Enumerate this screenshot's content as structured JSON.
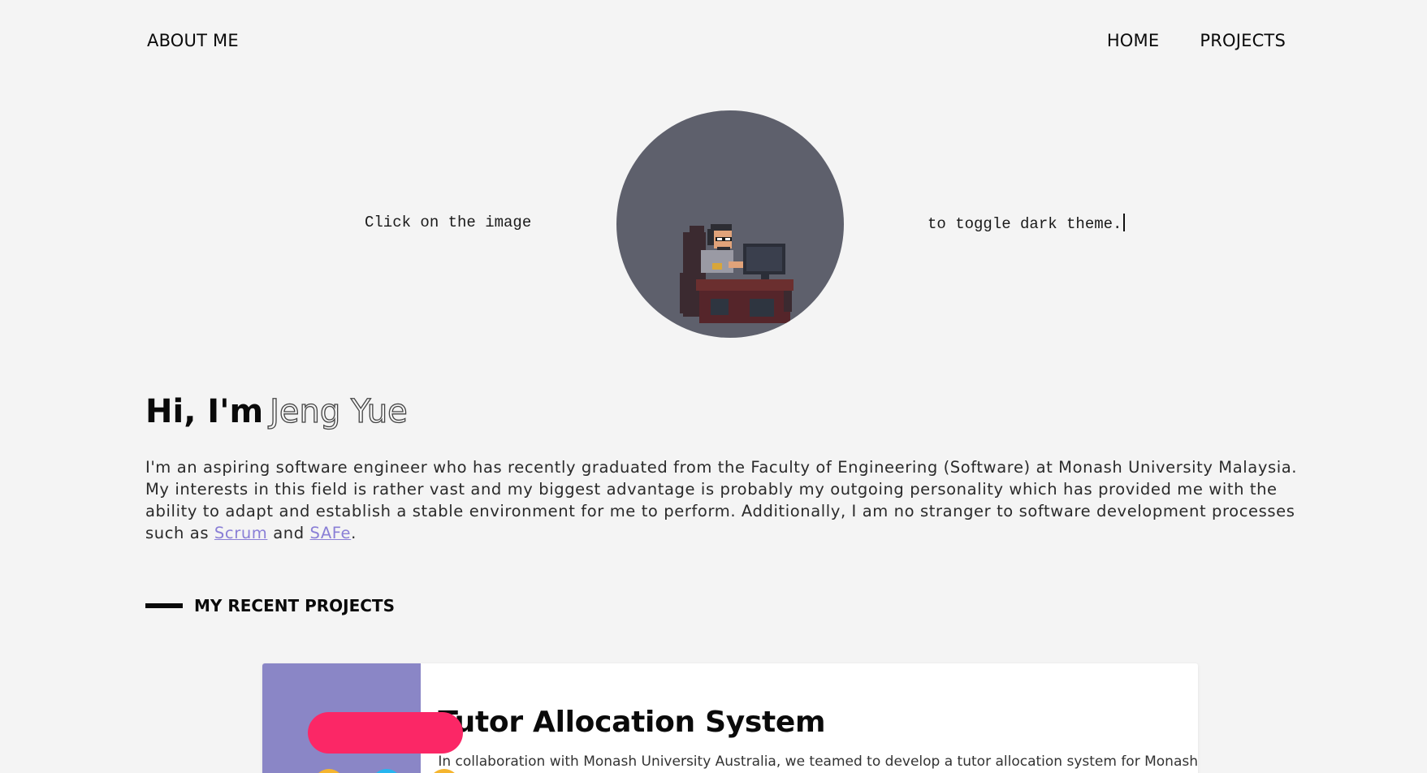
{
  "nav": {
    "brand": "ABOUT ME",
    "links": [
      "HOME",
      "PROJECTS"
    ]
  },
  "hero": {
    "left_text": "Click on the image",
    "right_text": "to toggle dark theme.",
    "avatar_bg": "#5e606c"
  },
  "intro": {
    "greeting": "Hi, I'm",
    "name": "Jeng Yue",
    "bio_text": "I'm an aspiring software engineer who has recently graduated from the Faculty of Engineering (Software) at Monash University Malaysia. My interests in this field is rather vast and my biggest advantage is probably my outgoing personality which has provided me with the ability to adapt and establish a stable environment for me to perform. Additionally, I am no stranger to software development processes such as",
    "link_scrum": "Scrum",
    "and_word": "and",
    "link_safe": "SAFe",
    "end_punct": "."
  },
  "section": {
    "title": "MY RECENT PROJECTS"
  },
  "projects": [
    {
      "title": "Tutor Allocation System",
      "description": "In collaboration with Monash University Australia, we teamed to develop a tutor allocation system for Monash"
    }
  ],
  "colors": {
    "background": "#f4f4f4",
    "link": "#8a7fd6",
    "thumb": "#8a86c6",
    "pill": "#fb2766",
    "dot_yellow": "#f5b52e",
    "dot_blue": "#26b5f0"
  },
  "icons": [
    "pixel-avatar-icon"
  ]
}
